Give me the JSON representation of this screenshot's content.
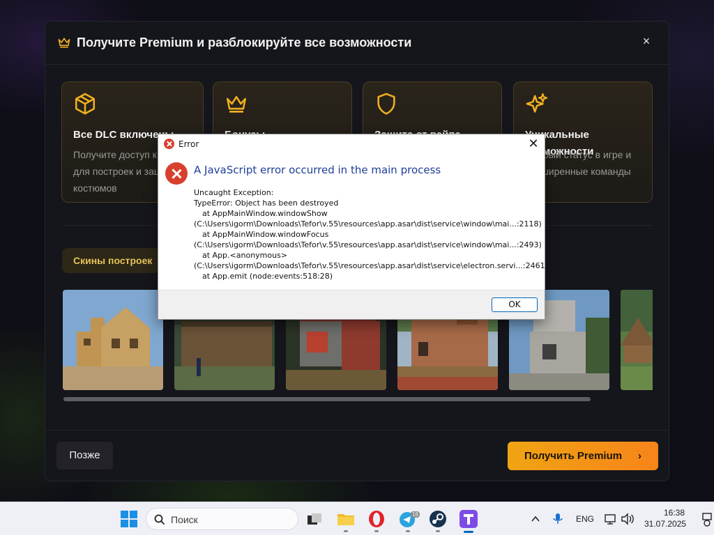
{
  "modal": {
    "title": "Получите Premium и разблокируйте все возможности",
    "close_glyph": "×",
    "cards": [
      {
        "icon": "box-icon",
        "title": "Все DLC включены",
        "desc": "Получите доступ к скинам для построек и защитных костюмов"
      },
      {
        "icon": "crown-icon",
        "title": "Бонусы",
        "desc": ""
      },
      {
        "icon": "shield-icon",
        "title": "Защита от вайпа",
        "desc": ""
      },
      {
        "icon": "sparkle-icon",
        "title": "Уникальные возможности",
        "desc": "Особый статус в игре и расширенные команды"
      }
    ],
    "tab_label": "Скины построек",
    "later_button": "Позже",
    "premium_button": "Получить Premium",
    "premium_chevron": "›",
    "accent_color": "#f0a413"
  },
  "dialog": {
    "title": "Error",
    "close_glyph": "✕",
    "heading": "A JavaScript error occurred in the main process",
    "lines": [
      "Uncaught Exception:",
      "TypeError: Object has been destroyed",
      "at AppMainWindow.windowShow",
      "(C:\\Users\\igorm\\Downloads\\Tefor\\v.55\\resources\\app.asar\\dist\\service\\window\\mai...:2118)",
      "at AppMainWindow.windowFocus",
      "(C:\\Users\\igorm\\Downloads\\Tefor\\v.55\\resources\\app.asar\\dist\\service\\window\\mai...:2493)",
      "at App.<anonymous>",
      "(C:\\Users\\igorm\\Downloads\\Tefor\\v.55\\resources\\app.asar\\dist\\service\\electron.servi...:2461)",
      "at App.emit (node:events:518:28)"
    ],
    "ok_label": "OK"
  },
  "taskbar": {
    "search_placeholder": "Поиск",
    "telegram_badge": "16",
    "language": "ENG",
    "time": "16:38",
    "date": "31.07.2025"
  }
}
